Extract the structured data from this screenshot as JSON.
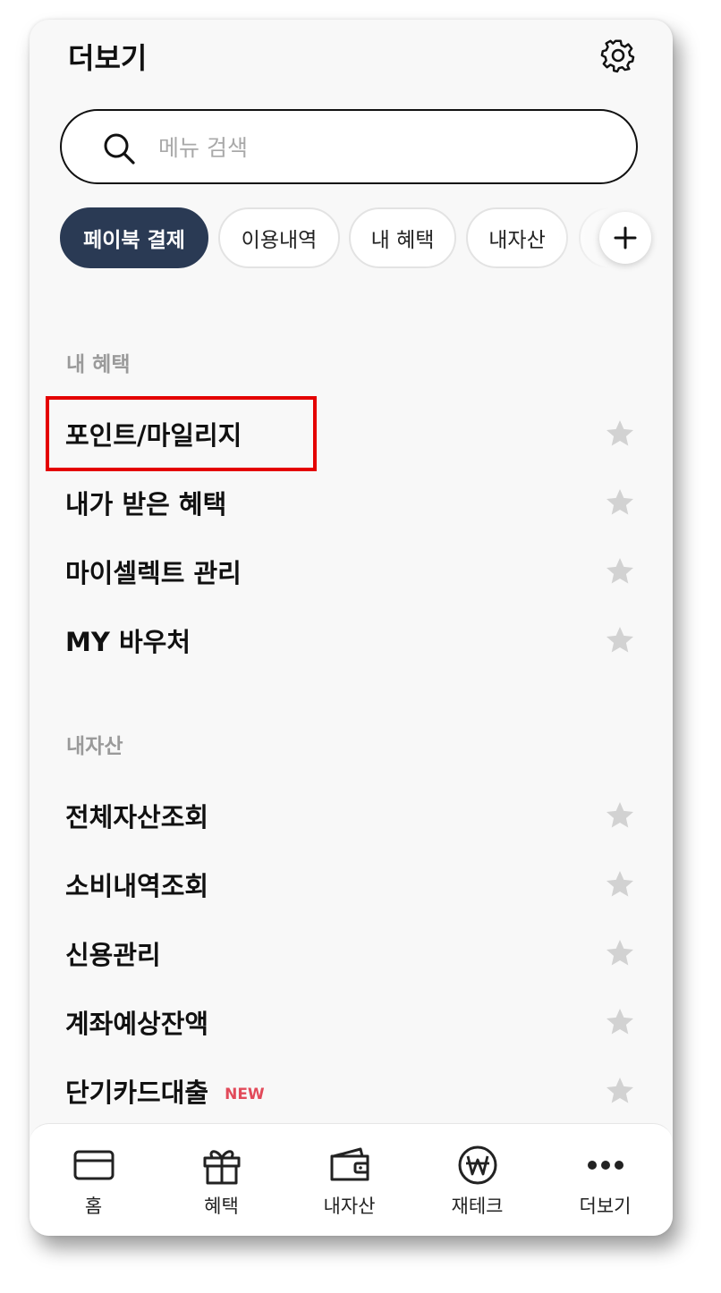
{
  "header": {
    "title": "더보기",
    "settings_icon": "gear-icon"
  },
  "search": {
    "placeholder": "메뉴 검색",
    "value": "",
    "icon": "search-icon"
  },
  "chips": [
    {
      "label": "페이북 결제",
      "active": true
    },
    {
      "label": "이용내역",
      "active": false
    },
    {
      "label": "내 혜택",
      "active": false
    },
    {
      "label": "내자산",
      "active": false
    }
  ],
  "add_button": {
    "icon": "plus-icon"
  },
  "sections": [
    {
      "title": "내 혜택",
      "items": [
        {
          "label": "포인트/마일리지",
          "highlighted": true
        },
        {
          "label": "내가 받은 혜택"
        },
        {
          "label": "마이셀렉트 관리"
        },
        {
          "label": "MY 바우처"
        }
      ]
    },
    {
      "title": "내자산",
      "items": [
        {
          "label": "전체자산조회"
        },
        {
          "label": "소비내역조회"
        },
        {
          "label": "신용관리"
        },
        {
          "label": "계좌예상잔액"
        },
        {
          "label": "단기카드대출",
          "badge": "NEW"
        }
      ]
    }
  ],
  "tabbar": [
    {
      "label": "홈",
      "icon": "card-icon"
    },
    {
      "label": "혜택",
      "icon": "gift-icon"
    },
    {
      "label": "내자산",
      "icon": "wallet-icon"
    },
    {
      "label": "재테크",
      "icon": "won-coin-icon"
    },
    {
      "label": "더보기",
      "icon": "more-dots-icon"
    }
  ],
  "colors": {
    "active_chip": "#2a3a54",
    "highlight": "#e40000",
    "new_badge": "#e24a5a",
    "star": "#d2d2d2"
  }
}
